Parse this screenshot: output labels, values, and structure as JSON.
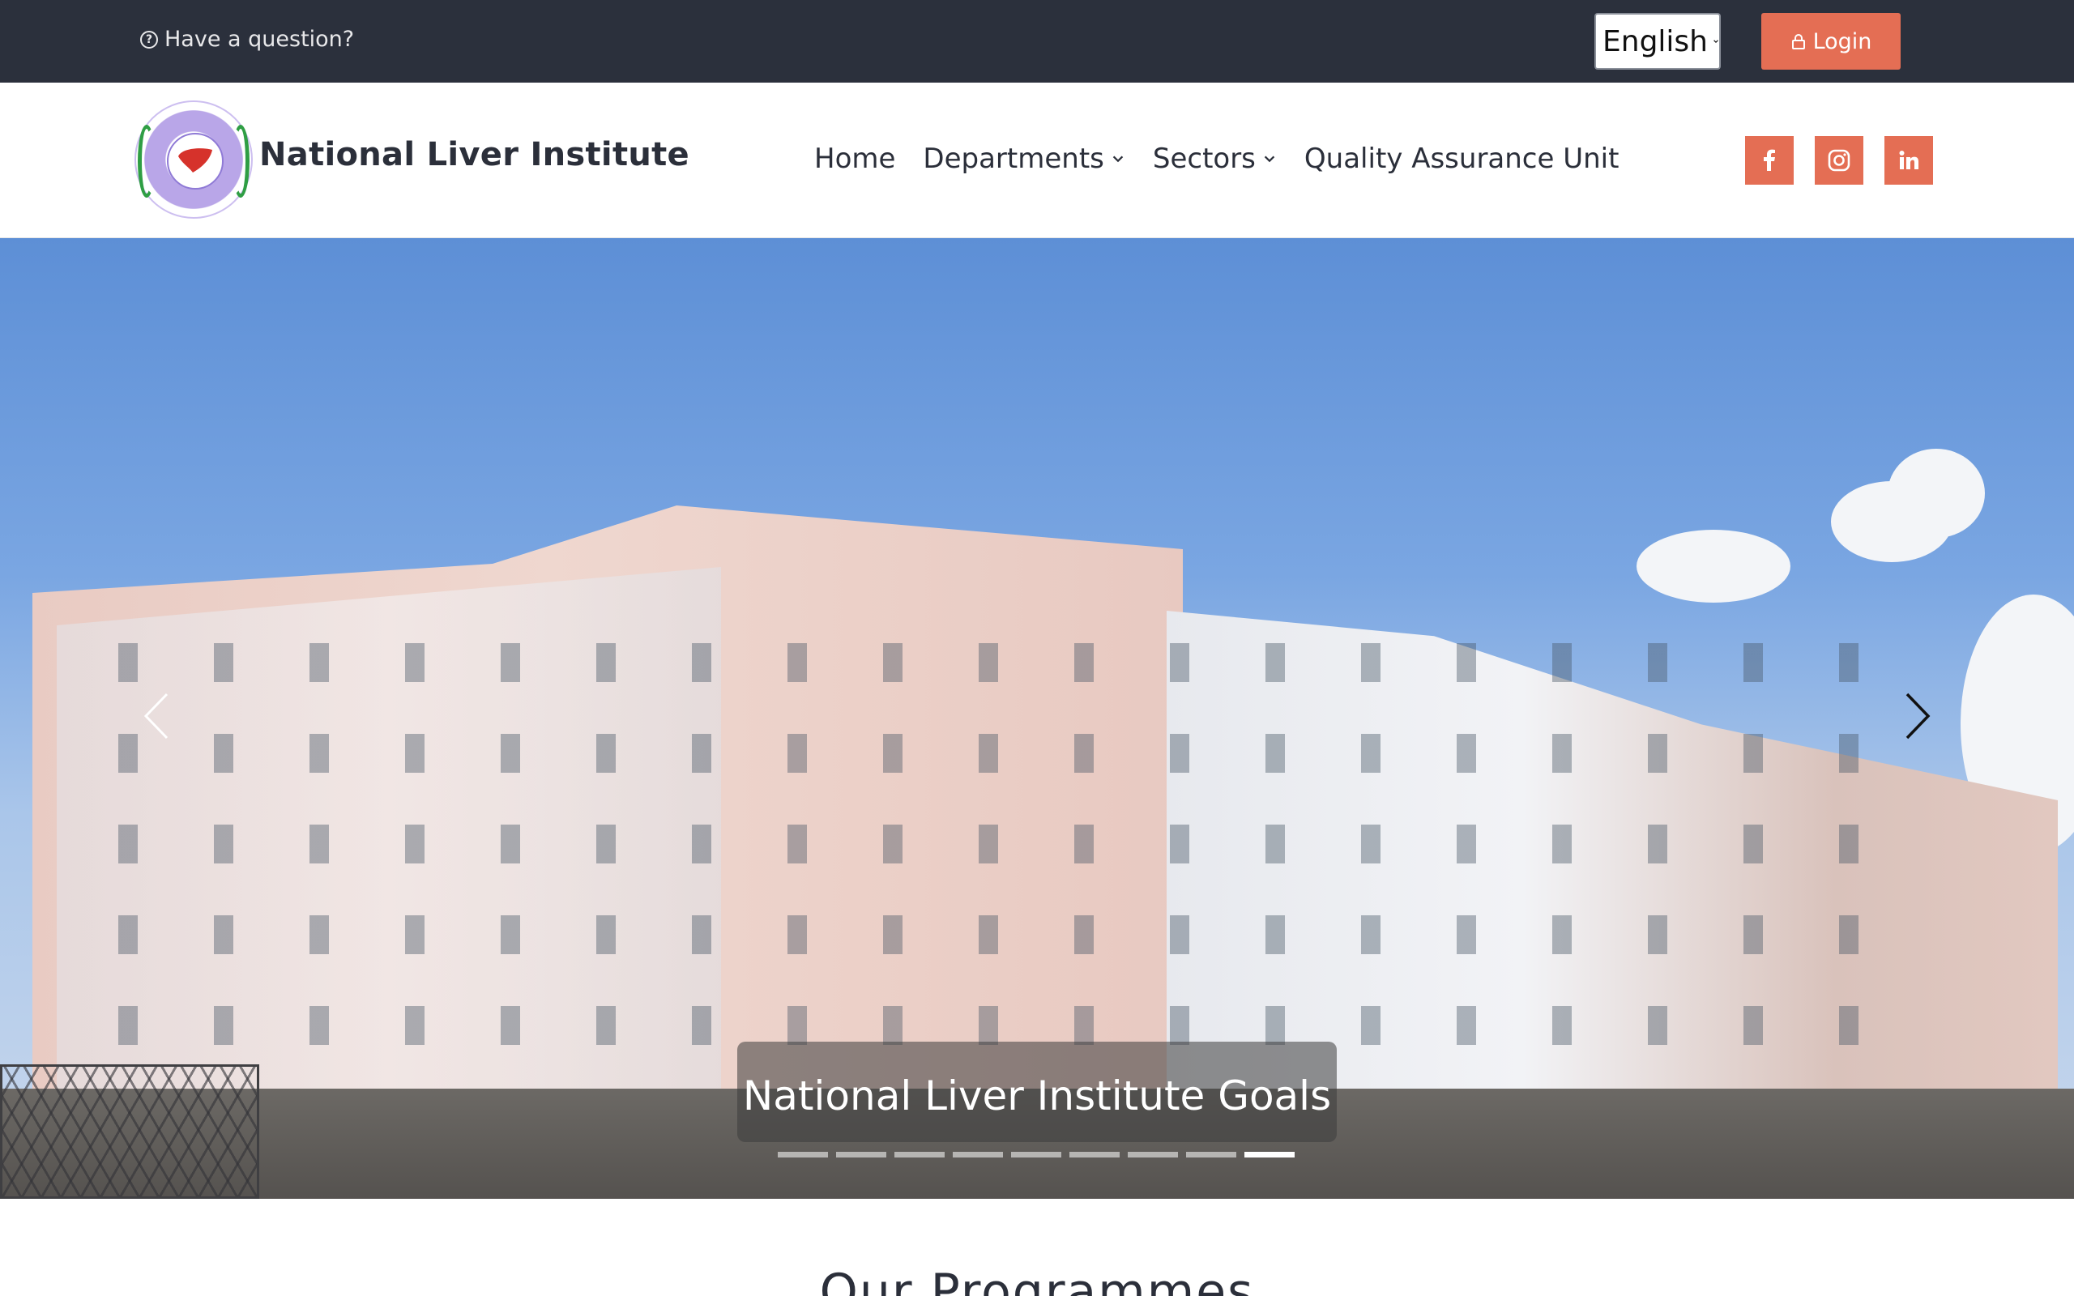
{
  "topbar": {
    "question_text": "Have a question?",
    "language": "English",
    "login_label": "Login"
  },
  "header": {
    "brand": "National Liver Institute",
    "nav": [
      {
        "label": "Home",
        "has_dropdown": false
      },
      {
        "label": "Departments",
        "has_dropdown": true
      },
      {
        "label": "Sectors",
        "has_dropdown": true
      },
      {
        "label": "Quality Assurance Unit",
        "has_dropdown": false
      }
    ],
    "social": [
      "facebook-icon",
      "instagram-icon",
      "linkedin-icon"
    ]
  },
  "hero": {
    "caption": "National Liver Institute Goals",
    "slide_count": 9,
    "active_slide": 9
  },
  "section": {
    "title": "Our Programmes"
  },
  "colors": {
    "topbar_bg": "#2b303c",
    "accent": "#e46e54",
    "text_dark": "#2b2f3a"
  }
}
